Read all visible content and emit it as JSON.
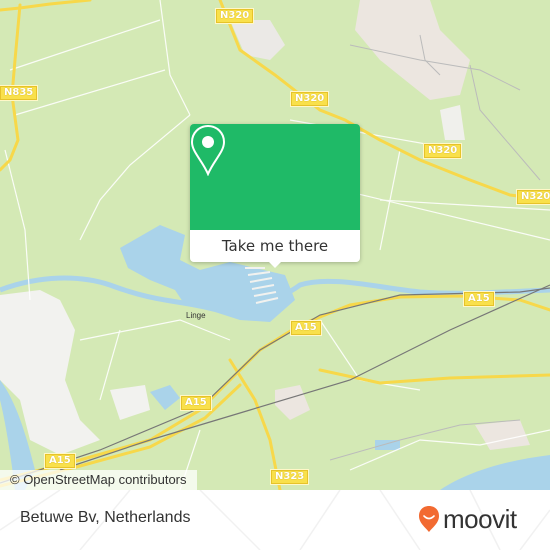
{
  "map": {
    "attribution": "© OpenStreetMap contributors",
    "colors": {
      "land": "#d4e9b5",
      "water": "#aad3ea",
      "urban": "#ece6e0",
      "industrial": "#f2f2ef",
      "road_major": "#f9e04b",
      "road_minor": "#ffffff",
      "rail": "#777777"
    },
    "road_labels": [
      {
        "name": "road-shield-n320-top",
        "text": "N320"
      },
      {
        "name": "road-shield-n835",
        "text": "N835"
      },
      {
        "name": "road-shield-n320-mid",
        "text": "N320"
      },
      {
        "name": "road-shield-n320-right",
        "text": "N320"
      },
      {
        "name": "road-shield-n320-far-right",
        "text": "N320"
      },
      {
        "name": "road-shield-a15-right",
        "text": "A15"
      },
      {
        "name": "road-shield-a15-center",
        "text": "A15"
      },
      {
        "name": "road-shield-a15-left",
        "text": "A15"
      },
      {
        "name": "road-shield-a15-bottom",
        "text": "A15"
      },
      {
        "name": "road-shield-n323",
        "text": "N323"
      }
    ],
    "place_labels": [
      {
        "name": "river-label-linge",
        "text": "Linge"
      }
    ]
  },
  "popup": {
    "action_label": "Take me there",
    "icon": "map-pin-icon",
    "accent_color": "#1fba67"
  },
  "footer": {
    "place_name": "Betuwe Bv, Netherlands",
    "brand": "moovit",
    "brand_color": "#f26a31"
  }
}
